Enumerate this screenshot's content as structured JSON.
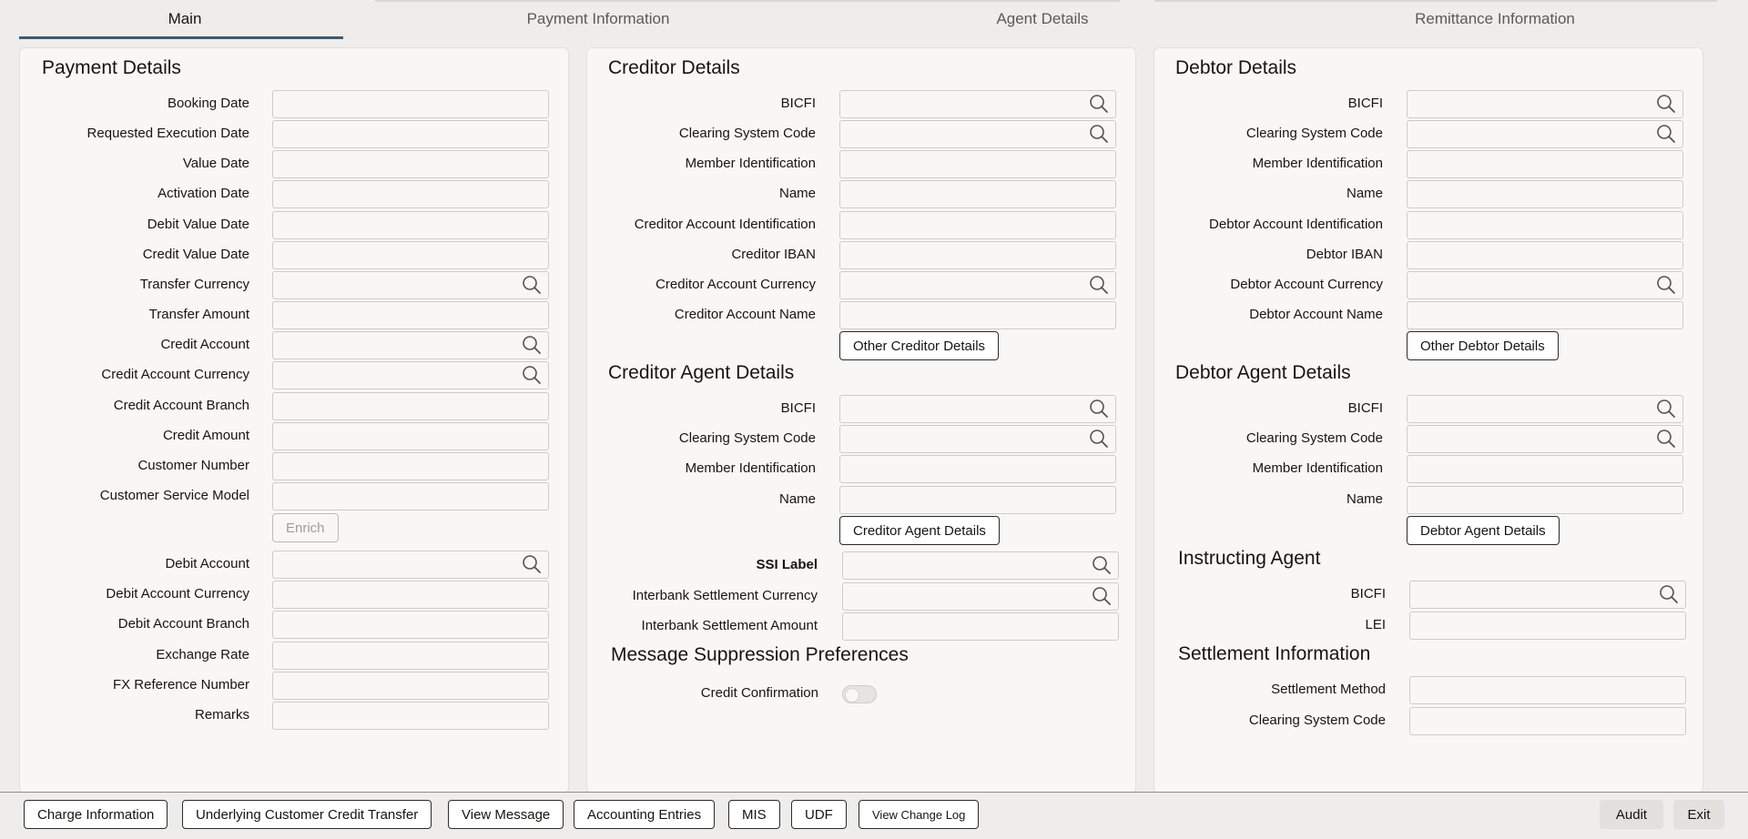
{
  "tabs": [
    {
      "label": "Main",
      "active": true
    },
    {
      "label": "Payment Information",
      "active": false
    },
    {
      "label": "Agent Details",
      "active": false
    },
    {
      "label": "Remittance Information",
      "active": false
    }
  ],
  "payment_details": {
    "title": "Payment Details",
    "fields": [
      {
        "label": "Booking Date",
        "value": "",
        "lookup": false
      },
      {
        "label": "Requested Execution Date",
        "value": "",
        "lookup": false
      },
      {
        "label": "Value Date",
        "value": "",
        "lookup": false
      },
      {
        "label": "Activation Date",
        "value": "",
        "lookup": false
      },
      {
        "label": "Debit Value Date",
        "value": "",
        "lookup": false
      },
      {
        "label": "Credit Value Date",
        "value": "",
        "lookup": false
      },
      {
        "label": "Transfer Currency",
        "value": "",
        "lookup": true
      },
      {
        "label": "Transfer Amount",
        "value": "",
        "lookup": false
      },
      {
        "label": "Credit Account",
        "value": "",
        "lookup": true
      },
      {
        "label": "Credit Account Currency",
        "value": "",
        "lookup": true
      },
      {
        "label": "Credit Account Branch",
        "value": "",
        "lookup": false
      },
      {
        "label": "Credit Amount",
        "value": "",
        "lookup": false
      },
      {
        "label": "Customer Number",
        "value": "",
        "lookup": false
      },
      {
        "label": "Customer Service Model",
        "value": "",
        "lookup": false
      }
    ],
    "enrich_label": "Enrich",
    "fields2": [
      {
        "label": "Debit Account",
        "value": "",
        "lookup": true
      },
      {
        "label": "Debit Account Currency",
        "value": "",
        "lookup": false
      },
      {
        "label": "Debit Account Branch",
        "value": "",
        "lookup": false
      },
      {
        "label": "Exchange Rate",
        "value": "",
        "lookup": false
      },
      {
        "label": "FX Reference Number",
        "value": "",
        "lookup": false
      },
      {
        "label": "Remarks",
        "value": "",
        "lookup": false
      }
    ]
  },
  "creditor_details": {
    "title": "Creditor Details",
    "fields": [
      {
        "label": "BICFI",
        "value": "",
        "lookup": true
      },
      {
        "label": "Clearing System Code",
        "value": "",
        "lookup": true
      },
      {
        "label": "Member Identification",
        "value": "",
        "lookup": false
      },
      {
        "label": "Name",
        "value": "",
        "lookup": false
      },
      {
        "label": "Creditor Account Identification",
        "value": "",
        "lookup": false
      },
      {
        "label": "Creditor IBAN",
        "value": "",
        "lookup": false
      },
      {
        "label": "Creditor Account Currency",
        "value": "",
        "lookup": true
      },
      {
        "label": "Creditor Account Name",
        "value": "",
        "lookup": false
      }
    ],
    "button_label": "Other Creditor Details"
  },
  "creditor_agent_details": {
    "title": "Creditor Agent Details",
    "fields": [
      {
        "label": "BICFI",
        "value": "",
        "lookup": true
      },
      {
        "label": "Clearing System Code",
        "value": "",
        "lookup": true
      },
      {
        "label": "Member Identification",
        "value": "",
        "lookup": false
      },
      {
        "label": "Name",
        "value": "",
        "lookup": false
      }
    ],
    "button_label": "Creditor Agent Details"
  },
  "settlement_misc": {
    "fields": [
      {
        "label": "SSI Label",
        "value": "",
        "lookup": true
      },
      {
        "label": "Interbank Settlement Currency",
        "value": "",
        "lookup": true
      },
      {
        "label": "Interbank Settlement Amount",
        "value": "",
        "lookup": false
      }
    ]
  },
  "message_suppression": {
    "title": "Message Suppression Preferences",
    "credit_confirmation_label": "Credit Confirmation",
    "credit_confirmation_on": false
  },
  "debtor_details": {
    "title": "Debtor Details",
    "fields": [
      {
        "label": "BICFI",
        "value": "",
        "lookup": true
      },
      {
        "label": "Clearing System Code",
        "value": "",
        "lookup": true
      },
      {
        "label": "Member Identification",
        "value": "",
        "lookup": false
      },
      {
        "label": "Name",
        "value": "",
        "lookup": false
      },
      {
        "label": "Debtor Account Identification",
        "value": "",
        "lookup": false
      },
      {
        "label": "Debtor IBAN",
        "value": "",
        "lookup": false
      },
      {
        "label": "Debtor Account Currency",
        "value": "",
        "lookup": true
      },
      {
        "label": "Debtor Account Name",
        "value": "",
        "lookup": false
      }
    ],
    "button_label": "Other Debtor Details"
  },
  "debtor_agent_details": {
    "title": "Debtor Agent Details",
    "fields": [
      {
        "label": "BICFI",
        "value": "",
        "lookup": true
      },
      {
        "label": "Clearing System Code",
        "value": "",
        "lookup": true
      },
      {
        "label": "Member Identification",
        "value": "",
        "lookup": false
      },
      {
        "label": "Name",
        "value": "",
        "lookup": false
      }
    ],
    "button_label": "Debtor Agent Details"
  },
  "instructing_agent": {
    "title": "Instructing Agent",
    "fields": [
      {
        "label": "BICFI",
        "value": "",
        "lookup": true
      },
      {
        "label": "LEI",
        "value": "",
        "lookup": false
      }
    ]
  },
  "settlement_information": {
    "title": "Settlement Information",
    "fields": [
      {
        "label": "Settlement Method",
        "value": "",
        "lookup": false
      },
      {
        "label": "Clearing System Code",
        "value": "",
        "lookup": false
      }
    ]
  },
  "footer": {
    "left_buttons": [
      "Charge Information",
      "Underlying Customer Credit Transfer",
      "View Message",
      "Accounting Entries",
      "MIS",
      "UDF",
      "View Change Log"
    ],
    "audit_label": "Audit",
    "exit_label": "Exit"
  },
  "icons": {
    "lookup": "search-icon"
  }
}
